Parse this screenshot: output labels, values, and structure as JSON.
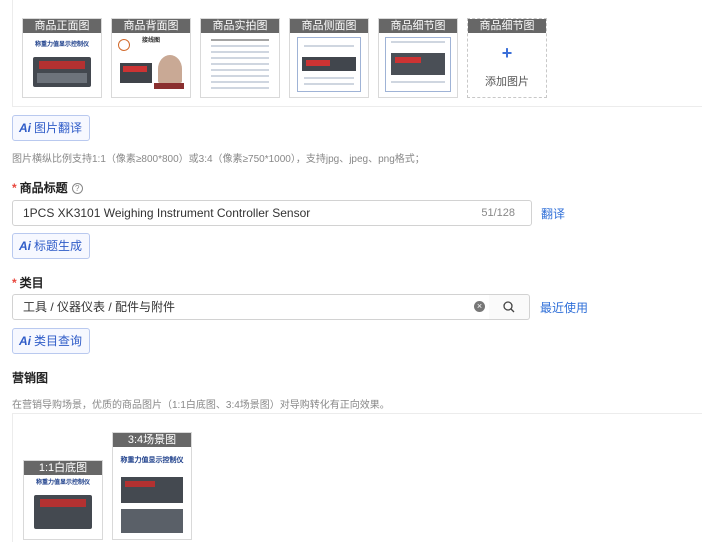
{
  "images": {
    "thumbs": [
      {
        "caption": "商品正面图"
      },
      {
        "caption": "商品背面图"
      },
      {
        "caption": "商品实拍图"
      },
      {
        "caption": "商品侧面图"
      },
      {
        "caption": "商品细节图"
      },
      {
        "caption": "商品细节图"
      }
    ],
    "add_label": "添加图片",
    "add_symbol": "+",
    "translate_button": "图片翻译",
    "hint": "图片横纵比例支持1:1（像素≥800*800）或3:4（像素≥750*1000），支持jpg、jpeg、png格式；",
    "embedded_text": {
      "product_name": "称重力值显示控制仪",
      "back_title": "接线图"
    }
  },
  "ai_badge": "Ai",
  "title_section": {
    "required_mark": "*",
    "label": "商品标题",
    "help_icon": "?",
    "value": "1PCS   XK3101 Weighing Instrument Controller Sensor",
    "counter": "51/128",
    "translate_link": "翻译",
    "generate_button": "标题生成"
  },
  "category_section": {
    "required_mark": "*",
    "label": "类目",
    "value": "工具 / 仪器仪表 / 配件与附件",
    "clear_icon": "×",
    "recent_link": "最近使用",
    "query_button": "类目查询"
  },
  "marketing_section": {
    "label": "营销图",
    "hint": "在营销导购场景，优质的商品图片（1:1白底图、3:4场景图）对导购转化有正向效果。",
    "thumbs": [
      {
        "caption": "1:1白底图"
      },
      {
        "caption": "3:4场景图"
      }
    ]
  },
  "colors": {
    "accent": "#2f6fd8",
    "required": "#e8473d",
    "caption_bg": "#3c3c3c"
  }
}
